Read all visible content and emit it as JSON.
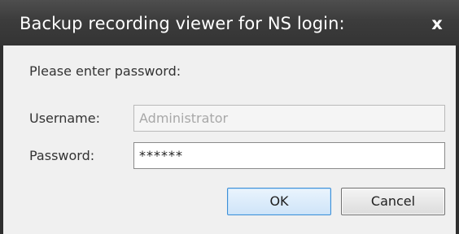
{
  "window": {
    "title": "Backup recording viewer for NS login:",
    "close_glyph": "x",
    "close_icon": "close-icon"
  },
  "form": {
    "prompt": "Please enter password:",
    "username_label": "Username:",
    "username_value": "Administrator",
    "password_label": "Password:",
    "password_value": "******"
  },
  "buttons": {
    "ok_label": "OK",
    "cancel_label": "Cancel"
  },
  "colors": {
    "titlebar": "#3c3c3c",
    "accent_focus": "#3f8fd6"
  }
}
